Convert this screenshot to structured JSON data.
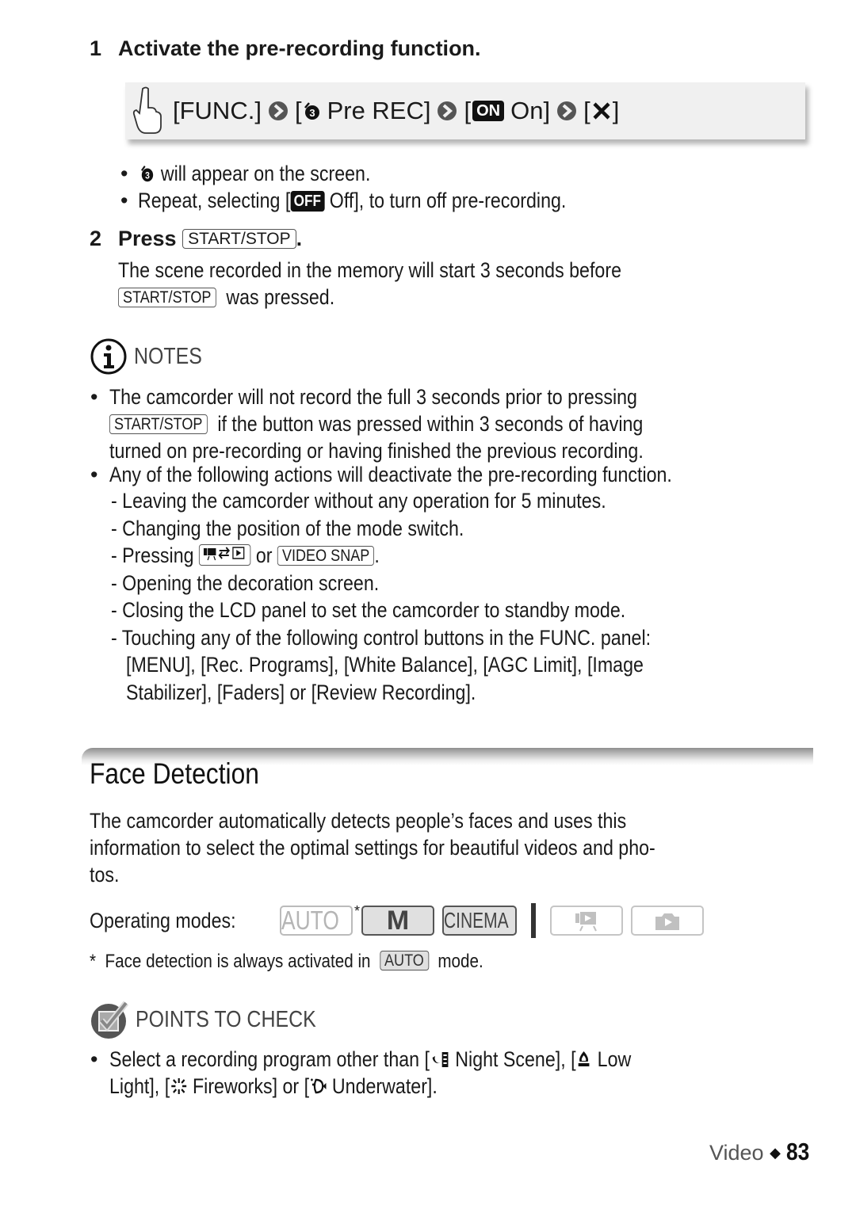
{
  "step1": {
    "number": "1",
    "title": "Activate the pre-recording function.",
    "func_path": {
      "touch_icon": "finger-touch-icon",
      "items": [
        "[FUNC.]",
        "[",
        "Pre REC]",
        "[",
        "On]",
        "[",
        "]"
      ],
      "func_label": "[FUNC.]",
      "prerec_label": "Pre REC]",
      "on_badge": "ON",
      "on_label": "On]",
      "open_bracket": "[",
      "close_bracket": "]",
      "close_icon": "close-x-icon",
      "arrow_icon": "chevron-arrow-icon",
      "prerec_icon": "pre-rec-3-icon"
    },
    "bullets": [
      {
        "icon": "pre-rec-3-icon",
        "text": "will appear on the screen."
      },
      {
        "prefix": "Repeat, selecting [",
        "badge": "OFF",
        "suffix": "Off], to turn off pre-recording."
      }
    ]
  },
  "step2": {
    "number": "2",
    "title": "Press",
    "key": "START/STOP",
    "period": ".",
    "desc_line1": "The scene recorded in the memory will start 3 seconds before",
    "desc_key": "START/STOP",
    "desc_line2": "was pressed."
  },
  "notes": {
    "label": "NOTES",
    "icon": "info-icon",
    "items": [
      {
        "line1": "The camcorder will not record the full 3 seconds prior to pressing",
        "key": "START/STOP",
        "line2": "if the button was pressed within 3 seconds of having",
        "line3": "turned on pre-recording or having finished the previous recording."
      },
      {
        "line1": "Any of the following actions will deactivate the pre-recording function.",
        "subitems": [
          "- Leaving the camcorder without any operation for 5 minutes.",
          "- Changing the position of the mode switch.",
          "- Pressing",
          "- Opening the decoration screen.",
          "- Closing the LCD panel to set the camcorder to standby mode.",
          "- Touching any of the following control buttons in the FUNC. panel:"
        ],
        "pressing_or": "or",
        "pressing_key2": "VIDEO SNAP",
        "pressing_period": ".",
        "func_cont1": "[MENU], [Rec. Programs], [White Balance], [AGC Limit], [Image",
        "func_cont2": "Stabilizer], [Faders] or [Review Recording]."
      }
    ]
  },
  "section": {
    "title": "Face Detection",
    "intro_line1": "The camcorder automatically detects people’s faces and uses this",
    "intro_line2": "information to select the optimal settings for beautiful videos and pho-",
    "intro_line3": "tos.",
    "operating_modes_label": "Operating modes:",
    "modes": [
      {
        "label": "AUTO",
        "active": false,
        "asterisk": "*"
      },
      {
        "label": "M",
        "active": true
      },
      {
        "label": "CINEMA",
        "active": true
      },
      {
        "icon": "video-playback-icon",
        "active": false
      },
      {
        "icon": "photo-playback-icon",
        "active": false
      }
    ],
    "footnote_star": "*",
    "footnote_text": "Face detection is always activated in",
    "footnote_key": "AUTO",
    "footnote_end": "mode."
  },
  "points": {
    "label": "POINTS TO CHECK",
    "icon": "checkbox-check-icon",
    "line1_a": "Select a recording program other than [",
    "line1_b": "Night Scene], [",
    "line1_c": "Low",
    "line2_a": "Light], [",
    "line2_b": "Fireworks] or [",
    "line2_c": "Underwater]."
  },
  "footer": {
    "section": "Video",
    "separator": "◆",
    "page": "83"
  }
}
